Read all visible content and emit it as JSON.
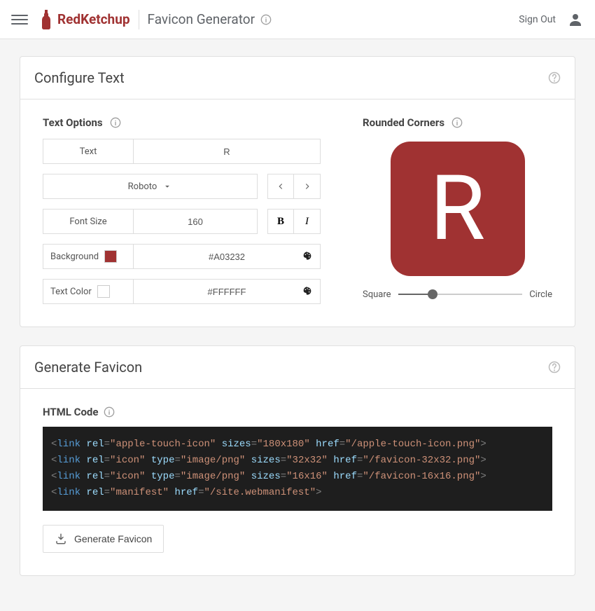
{
  "header": {
    "brand": "RedKetchup",
    "page_title": "Favicon Generator",
    "sign_out": "Sign Out"
  },
  "configure": {
    "title": "Configure Text",
    "text_options": {
      "heading": "Text Options",
      "text_label": "Text",
      "text_value": "R",
      "font_name": "Roboto",
      "font_size_label": "Font Size",
      "font_size_value": "160",
      "background_label": "Background",
      "background_value": "#A03232",
      "text_color_label": "Text Color",
      "text_color_value": "#FFFFFF"
    },
    "rounded_corners": {
      "heading": "Rounded Corners",
      "square_label": "Square",
      "circle_label": "Circle",
      "slider_percent": 28
    },
    "preview": {
      "letter": "R",
      "bg": "#A03232",
      "fg": "#FFFFFF"
    }
  },
  "generate": {
    "title": "Generate Favicon",
    "html_code_heading": "HTML Code",
    "button_label": "Generate Favicon",
    "code_lines": [
      {
        "rel": "apple-touch-icon",
        "type": null,
        "sizes": "180x180",
        "href": "/apple-touch-icon.png"
      },
      {
        "rel": "icon",
        "type": "image/png",
        "sizes": "32x32",
        "href": "/favicon-32x32.png"
      },
      {
        "rel": "icon",
        "type": "image/png",
        "sizes": "16x16",
        "href": "/favicon-16x16.png"
      },
      {
        "rel": "manifest",
        "type": null,
        "sizes": null,
        "href": "/site.webmanifest"
      }
    ]
  }
}
